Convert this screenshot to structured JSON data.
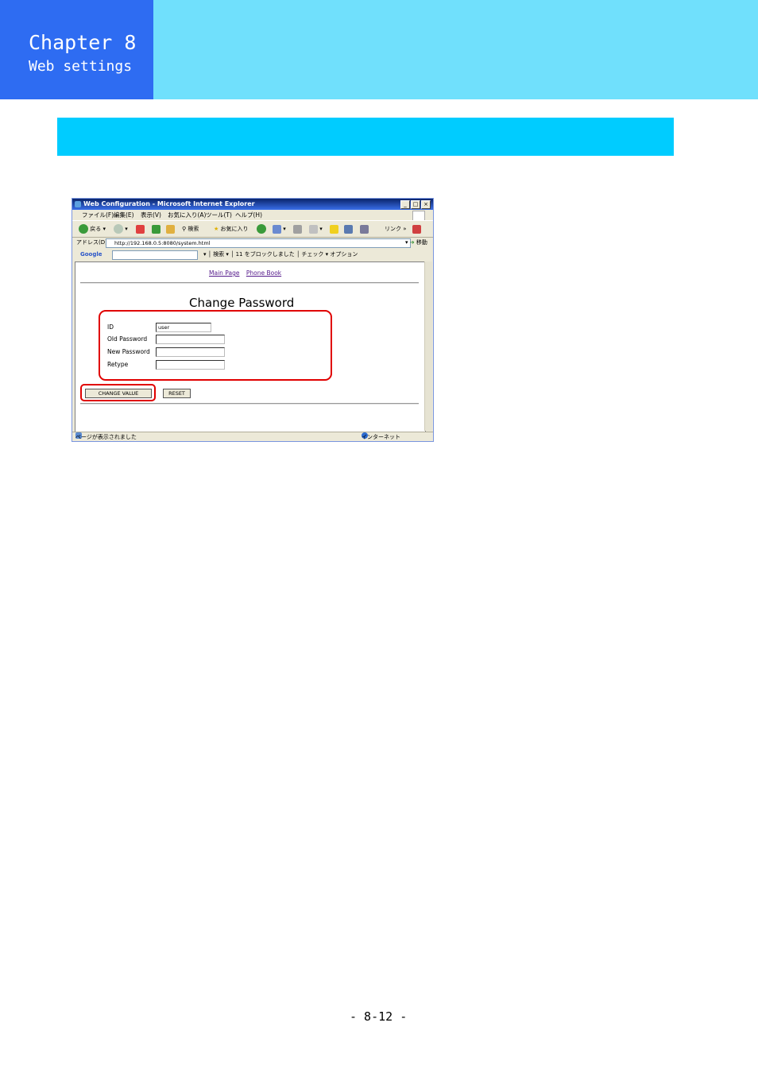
{
  "header": {
    "chapter": "Chapter 8",
    "subtitle": "Web settings"
  },
  "footer": {
    "page_number": "- 8-12 -"
  },
  "colors": {
    "header_dark": "#2e6cf2",
    "header_light": "#70e0fc",
    "section_bar": "#00ccff",
    "highlight": "#e00000"
  },
  "browser": {
    "title": "Web Configuration - Microsoft Internet Explorer",
    "window_buttons": [
      "_",
      "□",
      "×"
    ],
    "menu": [
      "ファイル(F)",
      "編集(E)",
      "表示(V)",
      "お気に入り(A)",
      "ツール(T)",
      "ヘルプ(H)"
    ],
    "toolbar": {
      "back": "戻る",
      "search": "検索",
      "favorites": "お気に入り",
      "links": "リンク"
    },
    "address_label": "アドレス(D)",
    "address_value": "http://192.168.0.5:8080/system.html",
    "go": "移動",
    "google_bar": {
      "logo": "Google",
      "search_btn": "検索",
      "popup": "11 をブロックしました",
      "check": "チェック",
      "options": "オプション"
    },
    "status_left": "ページが表示されました",
    "status_right": "インターネット"
  },
  "page": {
    "links": [
      "Main Page",
      "Phone Book"
    ],
    "title": "Change Password",
    "fields": [
      {
        "label": "ID",
        "value": "user"
      },
      {
        "label": "Old Password",
        "value": ""
      },
      {
        "label": "New Password",
        "value": ""
      },
      {
        "label": "Retype",
        "value": ""
      }
    ],
    "buttons": {
      "change": "CHANGE VALUE",
      "reset": "RESET"
    }
  }
}
